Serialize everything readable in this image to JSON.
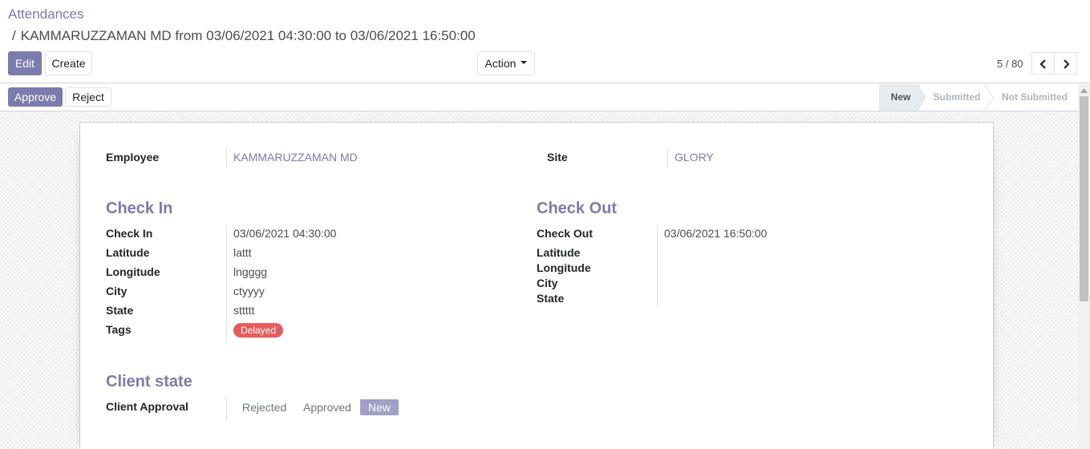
{
  "breadcrumb": {
    "root": "Attendances",
    "separator": "/",
    "current": "KAMMARUZZAMAN MD from 03/06/2021 04:30:00 to 03/06/2021 16:50:00"
  },
  "toolbar": {
    "edit_label": "Edit",
    "create_label": "Create",
    "action_label": "Action"
  },
  "pager": {
    "value": "5 / 80"
  },
  "statusbar": {
    "approve_label": "Approve",
    "reject_label": "Reject",
    "stages": [
      "New",
      "Submitted",
      "Not Submitted"
    ],
    "current_stage": "New"
  },
  "form": {
    "employee_label": "Employee",
    "employee_value": "KAMMARUZZAMAN MD",
    "site_label": "Site",
    "site_value": "GLORY",
    "check_in": {
      "title": "Check In",
      "fields": [
        {
          "label": "Check In",
          "value": "03/06/2021 04:30:00"
        },
        {
          "label": "Latitude",
          "value": "lattt"
        },
        {
          "label": "Longitude",
          "value": "lngggg"
        },
        {
          "label": "City",
          "value": "ctyyyy"
        },
        {
          "label": "State",
          "value": "sttttt"
        }
      ],
      "tags_label": "Tags",
      "tags": [
        "Delayed"
      ]
    },
    "check_out": {
      "title": "Check Out",
      "fields": [
        {
          "label": "Check Out",
          "value": "03/06/2021 16:50:00"
        },
        {
          "label": "Latitude",
          "value": ""
        },
        {
          "label": "Longitude",
          "value": ""
        },
        {
          "label": "City",
          "value": ""
        },
        {
          "label": "State",
          "value": ""
        }
      ]
    },
    "client_state": {
      "title": "Client state",
      "approval_label": "Client Approval",
      "options": [
        "Rejected",
        "Approved",
        "New"
      ],
      "selected": "New"
    }
  },
  "colors": {
    "primary": "#7c7bad",
    "tag_delayed": "#e65c5c",
    "selected_option": "#a09fc7"
  }
}
